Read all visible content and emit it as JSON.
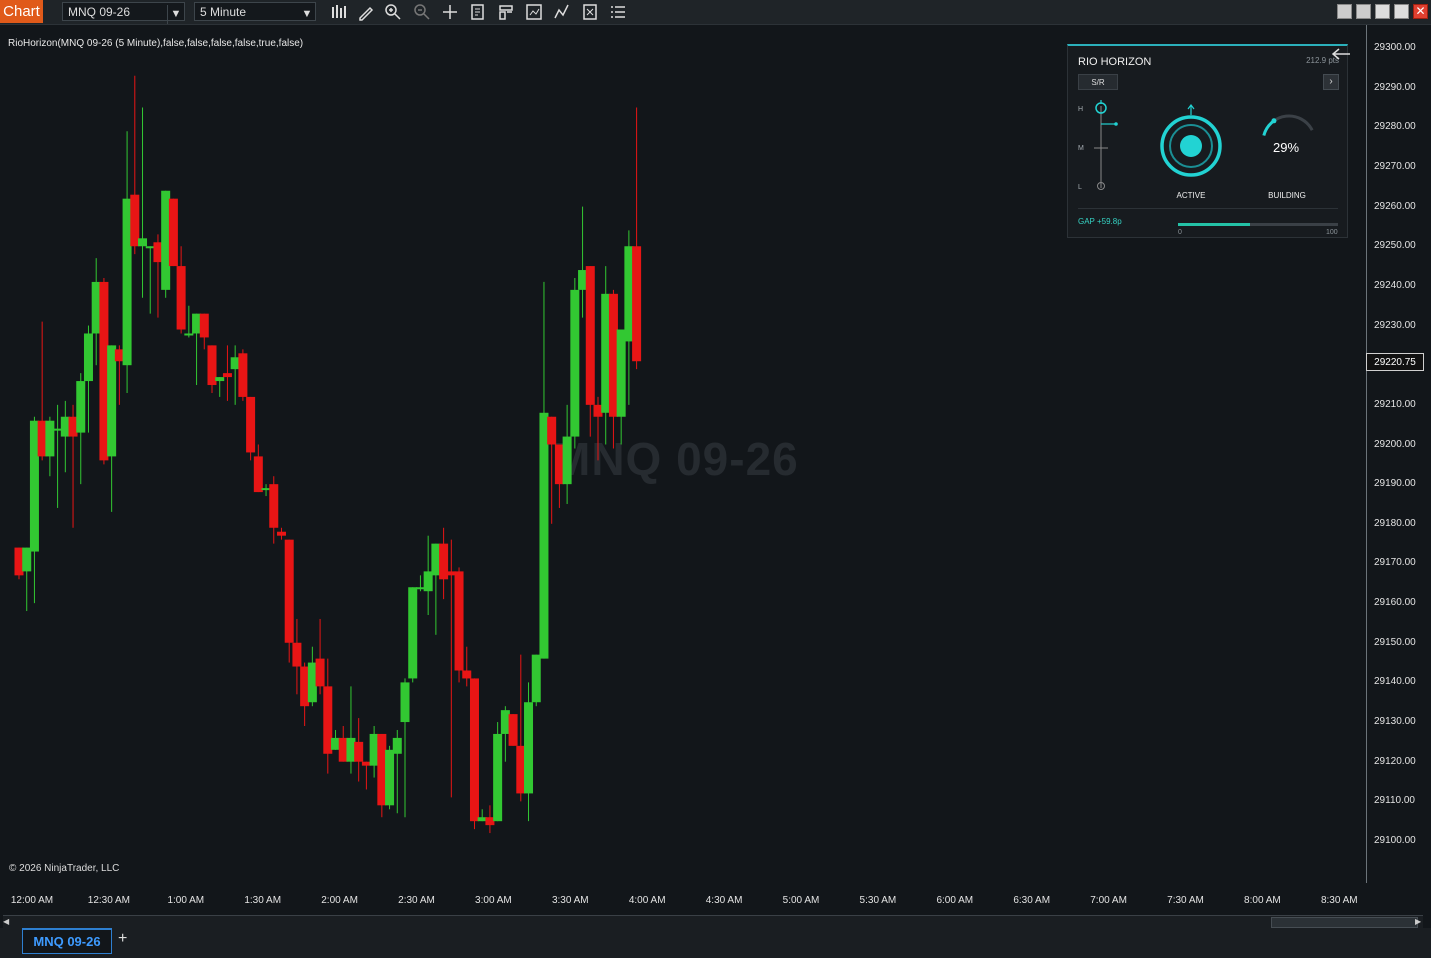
{
  "toolbar": {
    "chart_label": "Chart",
    "instrument": "MNQ 09-26",
    "interval": "5 Minute",
    "tools": [
      "bars-type-icon",
      "pencil-icon",
      "zoom-in-icon",
      "zoom-out-icon",
      "crosshair-icon",
      "data-box-icon",
      "templates-icon",
      "strategies-icon",
      "indicators-icon",
      "properties-icon",
      "menu-list-icon"
    ]
  },
  "chart": {
    "indicator_label": "RioHorizon(MNQ 09-26 (5 Minute),false,false,false,false,true,false)",
    "watermark": "MNQ 09-26",
    "copyright": "© 2026 NinjaTrader, LLC",
    "current_price": "29220.75",
    "up_color": "#32c832",
    "down_color": "#e81515",
    "price_ticks": [
      "29300.00",
      "29290.00",
      "29280.00",
      "29270.00",
      "29260.00",
      "29250.00",
      "29240.00",
      "29230.00",
      "29210.00",
      "29200.00",
      "29190.00",
      "29180.00",
      "29170.00",
      "29160.00",
      "29150.00",
      "29140.00",
      "29130.00",
      "29120.00",
      "29110.00",
      "29100.00"
    ],
    "time_ticks": [
      "12:00 AM",
      "12:30 AM",
      "1:00 AM",
      "1:30 AM",
      "2:00 AM",
      "2:30 AM",
      "3:00 AM",
      "3:30 AM",
      "4:00 AM",
      "4:30 AM",
      "5:00 AM",
      "5:30 AM",
      "6:00 AM",
      "6:30 AM",
      "7:00 AM",
      "7:30 AM",
      "8:00 AM",
      "8:30 AM"
    ]
  },
  "chart_data": {
    "type": "candlestick",
    "interval_minutes": 5,
    "ylim": [
      29100,
      29300
    ],
    "candles": [
      {
        "t": "11:55 PM",
        "o": 29174,
        "h": 29173,
        "l": 29166,
        "c": 29167
      },
      {
        "t": "12:00 AM",
        "o": 29168,
        "h": 29174,
        "l": 29158,
        "c": 29174
      },
      {
        "t": "12:05 AM",
        "o": 29173,
        "h": 29207,
        "l": 29160,
        "c": 29206
      },
      {
        "t": "12:10 AM",
        "o": 29206,
        "h": 29231,
        "l": 29196,
        "c": 29197
      },
      {
        "t": "12:15 AM",
        "o": 29197,
        "h": 29207,
        "l": 29192,
        "c": 29206
      },
      {
        "t": "12:20 AM",
        "o": 29204,
        "h": 29210,
        "l": 29184,
        "c": 29204
      },
      {
        "t": "12:25 AM",
        "o": 29202,
        "h": 29211,
        "l": 29193,
        "c": 29207
      },
      {
        "t": "12:30 AM",
        "o": 29207,
        "h": 29210,
        "l": 29179,
        "c": 29202
      },
      {
        "t": "12:35 AM",
        "o": 29203,
        "h": 29218,
        "l": 29190,
        "c": 29216
      },
      {
        "t": "12:40 AM",
        "o": 29216,
        "h": 29230,
        "l": 29203,
        "c": 29228
      },
      {
        "t": "12:45 AM",
        "o": 29228,
        "h": 29247,
        "l": 29220,
        "c": 29241
      },
      {
        "t": "12:50 AM",
        "o": 29241,
        "h": 29242,
        "l": 29195,
        "c": 29196
      },
      {
        "t": "12:55 AM",
        "o": 29197,
        "h": 29224,
        "l": 29183,
        "c": 29225
      },
      {
        "t": "1:00 AM",
        "o": 29224,
        "h": 29225,
        "l": 29210,
        "c": 29221
      },
      {
        "t": "1:05 AM",
        "o": 29220,
        "h": 29279,
        "l": 29213,
        "c": 29262
      },
      {
        "t": "1:10 AM",
        "o": 29263,
        "h": 29293,
        "l": 29248,
        "c": 29250
      },
      {
        "t": "1:15 AM",
        "o": 29250,
        "h": 29285,
        "l": 29237,
        "c": 29252
      },
      {
        "t": "1:20 AM",
        "o": 29250,
        "h": 29250,
        "l": 29233,
        "c": 29250
      },
      {
        "t": "1:25 AM",
        "o": 29251,
        "h": 29253,
        "l": 29232,
        "c": 29246
      },
      {
        "t": "1:30 AM",
        "o": 29239,
        "h": 29264,
        "l": 29237,
        "c": 29264
      },
      {
        "t": "1:35 AM",
        "o": 29262,
        "h": 29262,
        "l": 29246,
        "c": 29245
      },
      {
        "t": "1:40 AM",
        "o": 29245,
        "h": 29250,
        "l": 29228,
        "c": 29229
      },
      {
        "t": "1:45 AM",
        "o": 29228,
        "h": 29235,
        "l": 29227,
        "c": 29228
      },
      {
        "t": "1:50 AM",
        "o": 29228,
        "h": 29233,
        "l": 29215,
        "c": 29233
      },
      {
        "t": "1:55 AM",
        "o": 29233,
        "h": 29232,
        "l": 29224,
        "c": 29227
      },
      {
        "t": "2:00 AM",
        "o": 29225,
        "h": 29225,
        "l": 29213,
        "c": 29215
      },
      {
        "t": "2:05 AM",
        "o": 29216,
        "h": 29217,
        "l": 29212,
        "c": 29217
      },
      {
        "t": "2:10 AM",
        "o": 29218,
        "h": 29225,
        "l": 29211,
        "c": 29217
      },
      {
        "t": "2:15 AM",
        "o": 29219,
        "h": 29225,
        "l": 29210,
        "c": 29222
      },
      {
        "t": "2:20 AM",
        "o": 29223,
        "h": 29224,
        "l": 29211,
        "c": 29212
      },
      {
        "t": "2:25 AM",
        "o": 29212,
        "h": 29212,
        "l": 29196,
        "c": 29198
      },
      {
        "t": "2:30 AM",
        "o": 29197,
        "h": 29200,
        "l": 29188,
        "c": 29188
      },
      {
        "t": "2:35 AM",
        "o": 29189,
        "h": 29190,
        "l": 29187,
        "c": 29189
      },
      {
        "t": "2:40 AM",
        "o": 29190,
        "h": 29192,
        "l": 29175,
        "c": 29179
      },
      {
        "t": "2:45 AM",
        "o": 29178,
        "h": 29179,
        "l": 29176,
        "c": 29177
      },
      {
        "t": "2:50 AM",
        "o": 29176,
        "h": 29175,
        "l": 29145,
        "c": 29150
      },
      {
        "t": "2:55 AM",
        "o": 29150,
        "h": 29156,
        "l": 29137,
        "c": 29144
      },
      {
        "t": "3:00 AM",
        "o": 29144,
        "h": 29145,
        "l": 29129,
        "c": 29134
      },
      {
        "t": "3:05 AM",
        "o": 29135,
        "h": 29149,
        "l": 29134,
        "c": 29145
      },
      {
        "t": "3:10 AM",
        "o": 29146,
        "h": 29156,
        "l": 29137,
        "c": 29139
      },
      {
        "t": "3:15 AM",
        "o": 29139,
        "h": 29146,
        "l": 29117,
        "c": 29122
      },
      {
        "t": "3:20 AM",
        "o": 29123,
        "h": 29128,
        "l": 29124,
        "c": 29126
      },
      {
        "t": "3:25 AM",
        "o": 29126,
        "h": 29129,
        "l": 29120,
        "c": 29120
      },
      {
        "t": "3:30 AM",
        "o": 29120,
        "h": 29139,
        "l": 29117,
        "c": 29126
      },
      {
        "t": "3:35 AM",
        "o": 29125,
        "h": 29131,
        "l": 29115,
        "c": 29120
      },
      {
        "t": "3:40 AM",
        "o": 29120,
        "h": 29119,
        "l": 29113,
        "c": 29119
      },
      {
        "t": "3:45 AM",
        "o": 29119,
        "h": 29129,
        "l": 29116,
        "c": 29127
      },
      {
        "t": "3:50 AM",
        "o": 29127,
        "h": 29127,
        "l": 29106,
        "c": 29109
      },
      {
        "t": "3:55 AM",
        "o": 29109,
        "h": 29124,
        "l": 29108,
        "c": 29123
      },
      {
        "t": "4:00 AM",
        "o": 29122,
        "h": 29128,
        "l": 29107,
        "c": 29126
      },
      {
        "t": "4:05 AM",
        "o": 29130,
        "h": 29141,
        "l": 29106,
        "c": 29140
      },
      {
        "t": "4:10 AM",
        "o": 29141,
        "h": 29160,
        "l": 29140,
        "c": 29164
      },
      {
        "t": "4:15 AM",
        "o": 29164,
        "h": 29167,
        "l": 29163,
        "c": 29164
      },
      {
        "t": "4:20 AM",
        "o": 29163,
        "h": 29177,
        "l": 29157,
        "c": 29168
      },
      {
        "t": "4:25 AM",
        "o": 29167,
        "h": 29175,
        "l": 29152,
        "c": 29175
      },
      {
        "t": "4:30 AM",
        "o": 29175,
        "h": 29179,
        "l": 29161,
        "c": 29166
      },
      {
        "t": "4:35 AM",
        "o": 29168,
        "h": 29176,
        "l": 29111,
        "c": 29167
      },
      {
        "t": "4:40 AM",
        "o": 29168,
        "h": 29169,
        "l": 29140,
        "c": 29143
      },
      {
        "t": "4:45 AM",
        "o": 29143,
        "h": 29149,
        "l": 29139,
        "c": 29141
      },
      {
        "t": "4:50 AM",
        "o": 29141,
        "h": 29141,
        "l": 29103,
        "c": 29105
      },
      {
        "t": "4:55 AM",
        "o": 29105,
        "h": 29108,
        "l": 29105,
        "c": 29106
      },
      {
        "t": "5:00 AM",
        "o": 29106,
        "h": 29109,
        "l": 29102,
        "c": 29104
      },
      {
        "t": "5:05 AM",
        "o": 29105,
        "h": 29130,
        "l": 29105,
        "c": 29127
      },
      {
        "t": "5:10 AM",
        "o": 29127,
        "h": 29134,
        "l": 29120,
        "c": 29133
      },
      {
        "t": "5:15 AM",
        "o": 29132,
        "h": 29130,
        "l": 29124,
        "c": 29124
      },
      {
        "t": "5:20 AM",
        "o": 29124,
        "h": 29147,
        "l": 29110,
        "c": 29112
      },
      {
        "t": "5:25 AM",
        "o": 29112,
        "h": 29140,
        "l": 29105,
        "c": 29135
      },
      {
        "t": "5:30 AM",
        "o": 29135,
        "h": 29147,
        "l": 29134,
        "c": 29147
      },
      {
        "t": "5:35 AM",
        "o": 29146,
        "h": 29241,
        "l": 29179,
        "c": 29208
      },
      {
        "t": "5:40 AM",
        "o": 29207,
        "h": 29207,
        "l": 29180,
        "c": 29200
      },
      {
        "t": "5:45 AM",
        "o": 29200,
        "h": 29200,
        "l": 29184,
        "c": 29190
      },
      {
        "t": "5:50 AM",
        "o": 29190,
        "h": 29210,
        "l": 29185,
        "c": 29202
      },
      {
        "t": "5:55 AM",
        "o": 29202,
        "h": 29242,
        "l": 29199,
        "c": 29239
      },
      {
        "t": "6:00 AM",
        "o": 29239,
        "h": 29260,
        "l": 29232,
        "c": 29244
      },
      {
        "t": "6:05 AM",
        "o": 29245,
        "h": 29242,
        "l": 29202,
        "c": 29210
      },
      {
        "t": "6:10 AM",
        "o": 29210,
        "h": 29212,
        "l": 29196,
        "c": 29207
      },
      {
        "t": "6:15 AM",
        "o": 29208,
        "h": 29245,
        "l": 29200,
        "c": 29238
      },
      {
        "t": "6:20 AM",
        "o": 29238,
        "h": 29239,
        "l": 29199,
        "c": 29207
      },
      {
        "t": "6:25 AM",
        "o": 29207,
        "h": 29229,
        "l": 29200,
        "c": 29229
      },
      {
        "t": "6:30 AM",
        "o": 29226,
        "h": 29254,
        "l": 29210,
        "c": 29250
      },
      {
        "t": "6:35 AM",
        "o": 29250,
        "h": 29285,
        "l": 29219,
        "c": 29221
      }
    ]
  },
  "panel": {
    "title": "RIO HORIZON",
    "points": "212.9 pts",
    "sr_label": "S/R",
    "sr_next": "›",
    "level_labels": [
      "H",
      "M",
      "L"
    ],
    "state_label": "ACTIVE",
    "building_label": "BUILDING",
    "building_percent": 29,
    "building_percent_text": "29%",
    "gap_text": "GAP +59.8p",
    "gap_progress_percent": 45,
    "scale_min": "0",
    "scale_max": "100",
    "accent_color": "#22d3d3"
  },
  "tabs": {
    "active_tab": "MNQ 09-26",
    "add_label": "+"
  }
}
